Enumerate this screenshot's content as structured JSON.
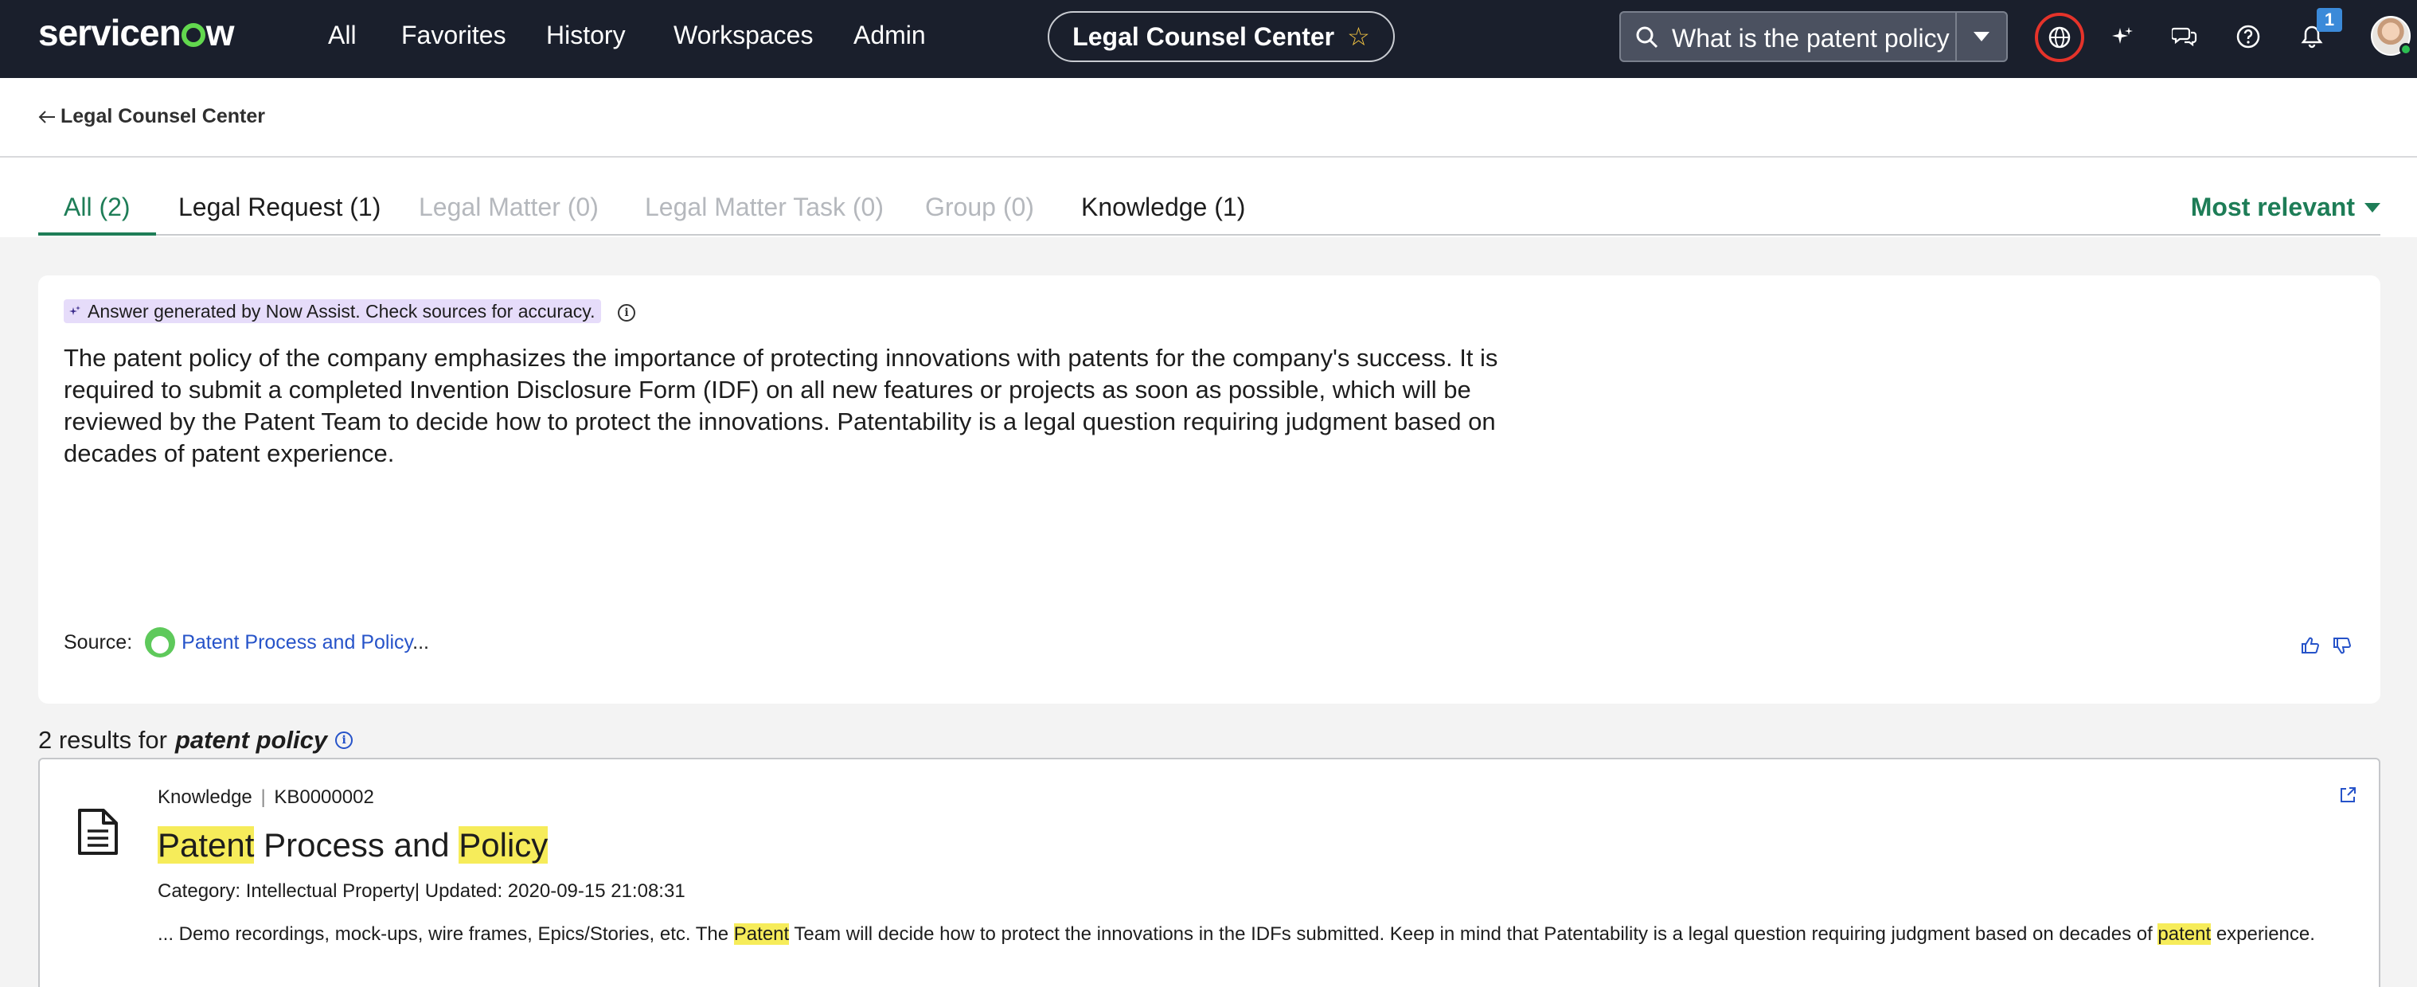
{
  "topbar": {
    "logo": "servicenow",
    "nav": [
      "All",
      "Favorites",
      "History",
      "Workspaces",
      "Admin"
    ],
    "workspace_title": "Legal Counsel Center",
    "search_value": "What is the patent policy",
    "notification_count": "1"
  },
  "breadcrumb": {
    "label": "Legal Counsel Center"
  },
  "tabs": [
    {
      "label": "All (2)",
      "state": "active"
    },
    {
      "label": "Legal Request (1)",
      "state": "enabled"
    },
    {
      "label": "Legal Matter (0)",
      "state": "disabled"
    },
    {
      "label": "Legal Matter Task (0)",
      "state": "disabled"
    },
    {
      "label": "Group (0)",
      "state": "disabled"
    },
    {
      "label": "Knowledge (1)",
      "state": "enabled"
    }
  ],
  "sort": {
    "label": "Most relevant"
  },
  "answer": {
    "disclaimer": "Answer generated by Now Assist. Check sources for accuracy.",
    "text": "The patent policy of the company emphasizes the importance of protecting innovations with patents for the company's success. It is required to submit a completed Invention Disclosure Form (IDF) on all new features or projects as soon as possible, which will be reviewed by the Patent Team to decide how to protect the innovations. Patentability is a legal question requiring judgment based on decades of patent experience.",
    "source_label": "Source:",
    "source_link": "Patent Process and Policy",
    "source_ellipsis": "..."
  },
  "results": {
    "count_prefix": "2 results for",
    "query": "patent policy"
  },
  "result_card": {
    "meta_type": "Knowledge",
    "meta_sep": "|",
    "meta_id": "KB0000002",
    "title_parts": [
      "Patent",
      " Process and ",
      "Policy"
    ],
    "category": "Category: Intellectual Property",
    "updated": "| Updated: 2020-09-15 21:08:31",
    "snippet_1": "... Demo recordings, mock-ups, wire frames, Epics/Stories, etc. The ",
    "snippet_hl_1": "Patent",
    "snippet_2": " Team will decide how to protect the innovations in the IDFs submitted. Keep in mind that Patentability is a legal question requiring judgment based on decades of ",
    "snippet_hl_2": "patent",
    "snippet_3": " experience."
  },
  "colors": {
    "topbar_bg": "#1a1f2c",
    "accent_green": "#1e7d57",
    "link_blue": "#2653c9",
    "highlight": "#f6ec5a",
    "ai_chip": "#e6dcfa",
    "globe_ring": "#e5332a"
  },
  "icons": [
    "search-icon",
    "chevron-down-icon",
    "star-icon",
    "globe-icon",
    "sparkle-icon",
    "chat-icon",
    "help-icon",
    "bell-icon",
    "back-arrow-icon",
    "info-icon",
    "thumbs-up-icon",
    "thumbs-down-icon",
    "document-icon",
    "external-link-icon"
  ]
}
